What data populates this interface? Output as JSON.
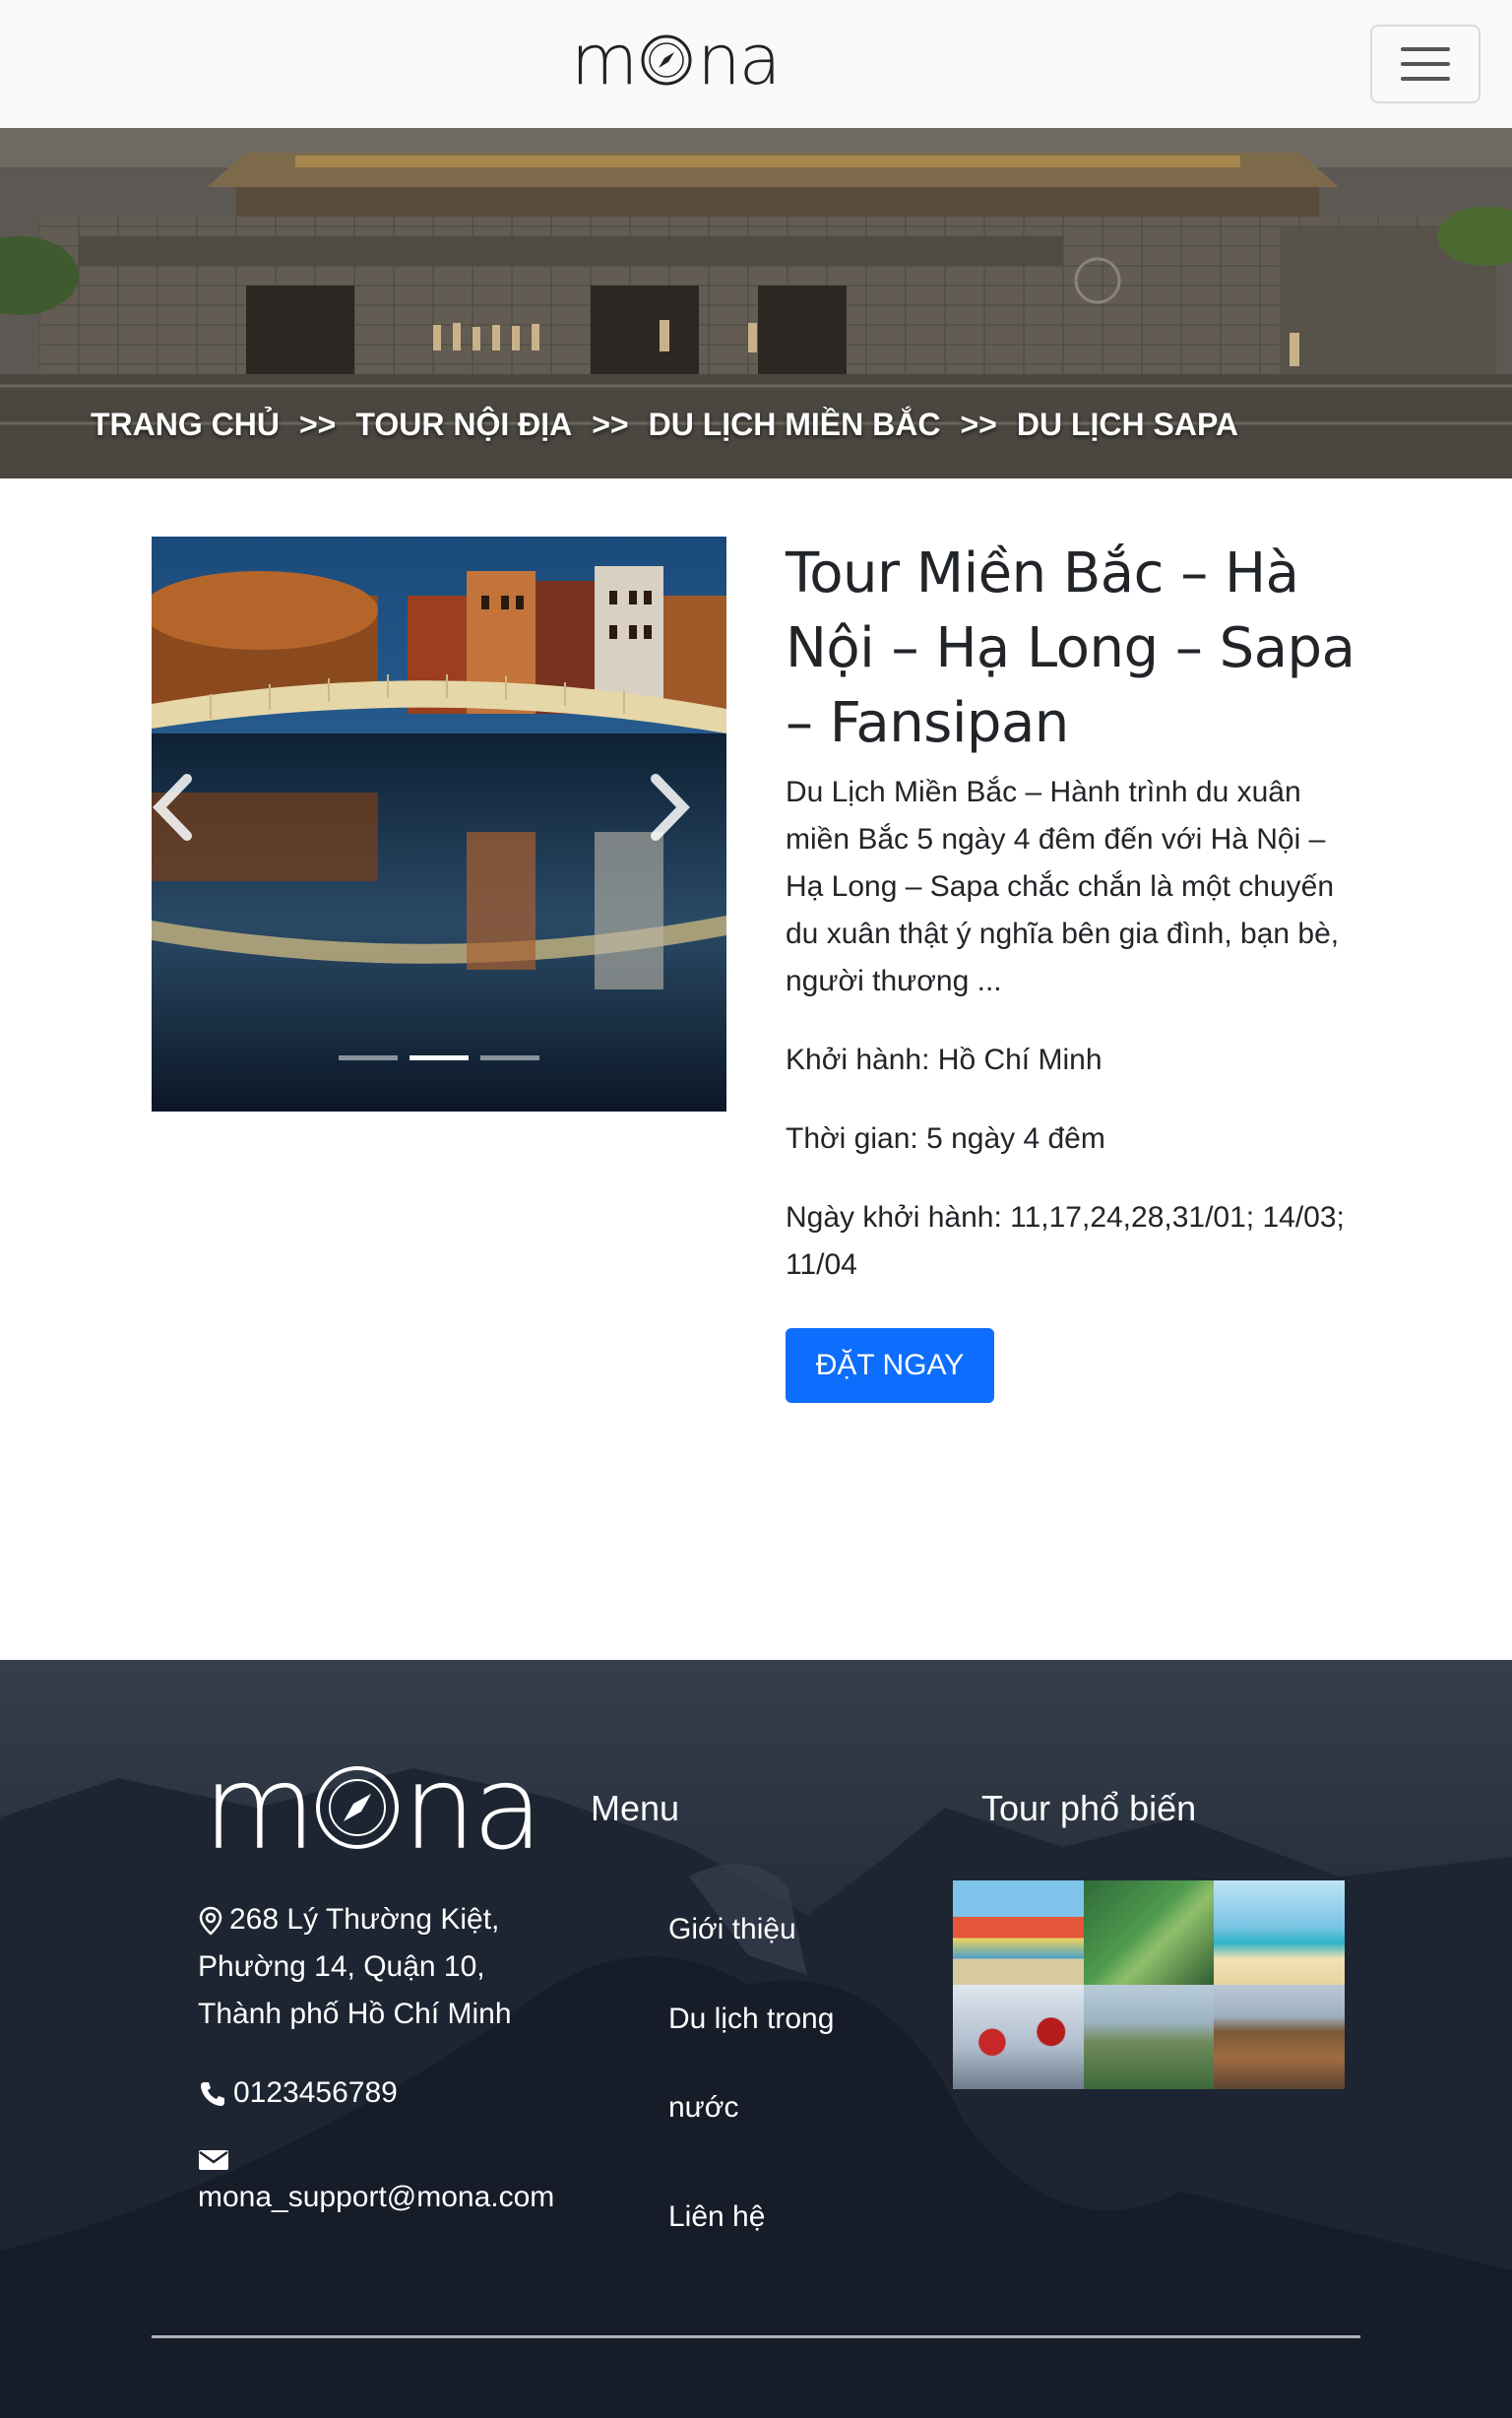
{
  "brand": {
    "logo_text": "mona"
  },
  "nav": {
    "toggler_label": "Toggle navigation"
  },
  "breadcrumb": [
    {
      "label": "TRANG CHỦ"
    },
    {
      "label": "TOUR NỘI ĐỊA"
    },
    {
      "label": "DU LỊCH MIỀN BẮC"
    },
    {
      "label": "DU LỊCH SAPA"
    }
  ],
  "breadcrumb_separator": ">>",
  "tour": {
    "title": "Tour Miền Bắc – Hà Nội – Hạ Long – Sapa – Fansipan",
    "description": "Du Lịch Miền Bắc – Hành trình du xuân miền Bắc 5 ngày 4 đêm đến với Hà Nội – Hạ Long – Sapa chắc chắn là một chuyến du xuân thật ý nghĩa bên gia đình, bạn bè, người thương ...",
    "departure": "Khởi hành: Hồ Chí Minh",
    "duration": "Thời gian: 5 ngày 4 đêm",
    "dates": "Ngày khởi hành: 11,17,24,28,31/01; 14/03; 11/04",
    "book_label": "ĐẶT NGAY"
  },
  "carousel": {
    "slide_count": 3,
    "active_index": 1
  },
  "footer": {
    "logo_text": "mona",
    "address": "268 Lý Thường Kiệt, Phường 14, Quận 10, Thành phố Hồ Chí Minh",
    "phone": "0123456789",
    "email": "mona_support@mona.com",
    "menu_title": "Menu",
    "menu": [
      "Giới thiệu",
      "Du lịch trong nước",
      "Liên hệ"
    ],
    "popular_title": "Tour phổ biến"
  },
  "colors": {
    "primary": "#0d6efd",
    "navbar_bg": "#f8f9fa",
    "footer_bg": "#1d2431"
  }
}
